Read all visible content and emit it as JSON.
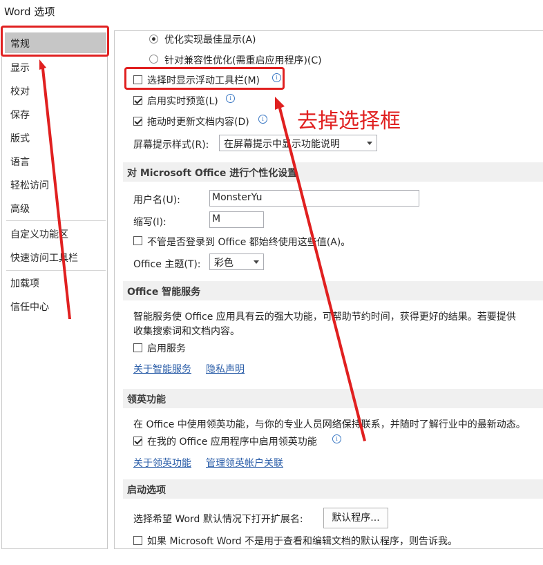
{
  "window": {
    "title": "Word 选项"
  },
  "sidebar": {
    "items": [
      {
        "label": "常规"
      },
      {
        "label": "显示"
      },
      {
        "label": "校对"
      },
      {
        "label": "保存"
      },
      {
        "label": "版式"
      },
      {
        "label": "语言"
      },
      {
        "label": "轻松访问"
      },
      {
        "label": "高级"
      },
      {
        "label": "自定义功能区"
      },
      {
        "label": "快速访问工具栏"
      },
      {
        "label": "加载项"
      },
      {
        "label": "信任中心"
      }
    ],
    "selected": "常规"
  },
  "ui_options": {
    "radio_best": "优化实现最佳显示(A)",
    "radio_compat": "针对兼容性优化(需重启应用程序)(C)",
    "mini_toolbar": "选择时显示浮动工具栏(M)",
    "live_preview": "启用实时预览(L)",
    "drag_update": "拖动时更新文档内容(D)",
    "screentip_label": "屏幕提示样式(R):",
    "screentip_value": "在屏幕提示中显示功能说明",
    "mini_toolbar_checked": false,
    "live_preview_checked": true,
    "drag_update_checked": true
  },
  "personalize": {
    "header": "对 Microsoft Office 进行个性化设置",
    "username_label": "用户名(U):",
    "username_value": "MonsterYu",
    "initials_label": "缩写(I):",
    "initials_value": "M",
    "always_use": "不管是否登录到 Office 都始终使用这些值(A)。",
    "theme_label": "Office 主题(T):",
    "theme_value": "彩色"
  },
  "intelligent": {
    "header": "Office 智能服务",
    "desc_line1": "智能服务使 Office 应用具有云的强大功能，可帮助节约时间，获得更好的结果。若要提供",
    "desc_line2": "收集搜索词和文档内容。",
    "enable": "启用服务",
    "about_link": "关于智能服务",
    "privacy_link": "隐私声明"
  },
  "linkedin": {
    "header": "领英功能",
    "desc": "在 Office 中使用领英功能，与你的专业人员网络保持联系，并随时了解行业中的最新动态。",
    "enable": "在我的 Office 应用程序中启用领英功能",
    "about_link": "关于领英功能",
    "manage_link": "管理领英帐户关联"
  },
  "startup": {
    "header": "启动选项",
    "default_ext_label": "选择希望 Word 默认情况下打开扩展名:",
    "default_button": "默认程序...",
    "tell_me": "如果 Microsoft Word 不是用于查看和编辑文档的默认程序，则告诉我。"
  },
  "annotation": {
    "text": "去掉选择框",
    "color": "#e02020"
  }
}
